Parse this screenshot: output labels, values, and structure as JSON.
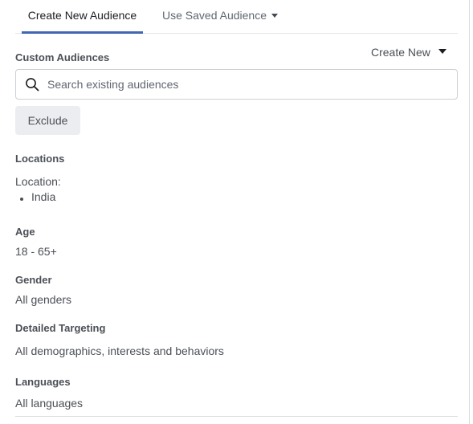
{
  "tabs": {
    "create_new": "Create New Audience",
    "use_saved": "Use Saved Audience"
  },
  "custom_audiences": {
    "label": "Custom Audiences",
    "create_new_label": "Create New",
    "search_placeholder": "Search existing audiences",
    "search_value": "",
    "exclude_label": "Exclude"
  },
  "locations": {
    "label": "Locations",
    "sub_label": "Location:",
    "items": [
      "India"
    ]
  },
  "age": {
    "label": "Age",
    "value": "18 - 65+"
  },
  "gender": {
    "label": "Gender",
    "value": "All genders"
  },
  "detailed_targeting": {
    "label": "Detailed Targeting",
    "value": "All demographics, interests and behaviors"
  },
  "languages": {
    "label": "Languages",
    "value": "All languages"
  },
  "colors": {
    "accent": "#4267b2",
    "text": "#4b4f56",
    "border": "#ccd0d5",
    "button_bg": "#ebedf0"
  }
}
